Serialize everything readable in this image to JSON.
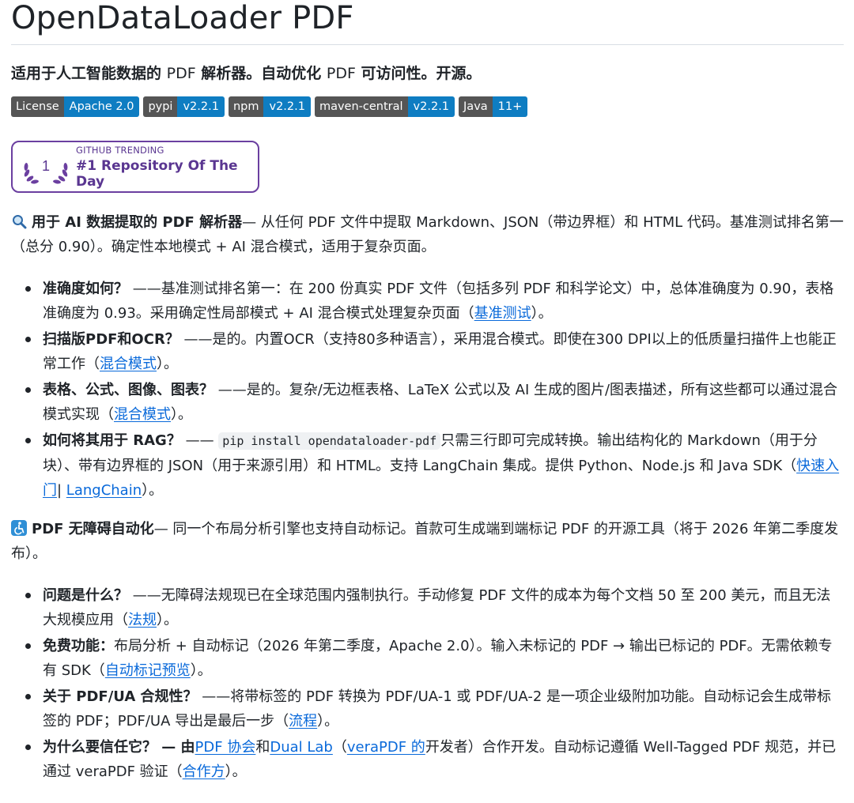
{
  "title": "OpenDataLoader PDF",
  "subtitle": {
    "a": "适用于人工智能数据的 ",
    "b": "PDF",
    "c": " 解析器。自动优化 ",
    "d": "PDF",
    "e": " 可访问性。开源。"
  },
  "badges": [
    {
      "label": "License",
      "value": "Apache 2.0"
    },
    {
      "label": "pypi",
      "value": "v2.2.1"
    },
    {
      "label": "npm",
      "value": "v2.2.1"
    },
    {
      "label": "maven-central",
      "value": "v2.2.1"
    },
    {
      "label": "Java",
      "value": "11+"
    }
  ],
  "trending": {
    "rank": "1",
    "kicker": "GITHUB TRENDING",
    "headline": "#1 Repository Of The Day"
  },
  "section1": {
    "icon": "magnifier-icon",
    "lead": "用于 AI 数据提取的 PDF 解析器",
    "text": "— 从任何 PDF 文件中提取 Markdown、JSON（带边界框）和 HTML 代码。基准测试排名第一（总分 0.90）。确定性本地模式 + AI 混合模式，适用于复杂页面。",
    "items": [
      {
        "q": "准确度如何？",
        "t": " ——基准测试排名第一：在 200 份真实 PDF 文件（包括多列 PDF 和科学论文）中，总体准确度为 0.90，表格准确度为 0.93。采用确定性局部模式 + AI 混合模式处理复杂页面（",
        "link": "基准测试",
        "end": "）。"
      },
      {
        "q": "扫描版PDF和OCR？",
        "t": " ——是的。内置OCR（支持80多种语言），采用混合模式。即使在300 DPI以上的低质量扫描件上也能正常工作（",
        "link": "混合模式",
        "end": "）。"
      },
      {
        "q": "表格、公式、图像、图表？",
        "t": " ——是的。复杂/无边框表格、LaTeX 公式以及 AI 生成的图片/图表描述，所有这些都可以通过混合模式实现（",
        "link": "混合模式",
        "end": "）。"
      },
      {
        "q": "如何将其用于 RAG？",
        "t1": " —— ",
        "code": "pip install opendataloader-pdf",
        "t2": "只需三行即可完成转换。输出结构化的 Markdown（用于分块）、带有边界框的 JSON（用于来源引用）和 HTML。支持 LangChain 集成。提供 Python、Node.js 和 Java SDK（",
        "link1": "快速入门",
        "sep": "| ",
        "link2": "LangChain",
        "end": "）。"
      }
    ]
  },
  "section2": {
    "icon": "accessibility-icon",
    "lead": "PDF 无障碍自动化",
    "text": "— 同一个布局分析引擎也支持自动标记。首款可生成端到端标记 PDF 的开源工具（将于 2026 年第二季度发布）。",
    "items": [
      {
        "q": "问题是什么？",
        "t": " ——无障碍法规现已在全球范围内强制执行。手动修复 PDF 文件的成本为每个文档 50 至 200 美元，而且无法大规模应用（",
        "link": "法规",
        "end": "）。"
      },
      {
        "q": "免费功能：",
        "t": "布局分析 + 自动标记（2026 年第二季度，Apache 2.0）。输入未标记的 PDF → 输出已标记的 PDF。无需依赖专有 SDK（",
        "link": "自动标记预览",
        "end": "）。"
      },
      {
        "q": "关于 PDF/UA 合规性？",
        "t": " ——将带标签的 PDF 转换为 PDF/UA-1 或 PDF/UA-2 是一项企业级附加功能。自动标记会生成带标签的 PDF；PDF/UA 导出是最后一步（",
        "link": "流程",
        "end": "）。"
      },
      {
        "q": "为什么要信任它？ — 由",
        "link1": "PDF 协会",
        "mid1": "和",
        "link2": "Dual Lab",
        "mid2": "（",
        "link3": "veraPDF 的",
        "t": "开发者）合作开发。自动标记遵循 Well-Tagged PDF 规范，并已通过 veraPDF 验证（",
        "link4": "合作方",
        "end": "）。"
      }
    ]
  }
}
